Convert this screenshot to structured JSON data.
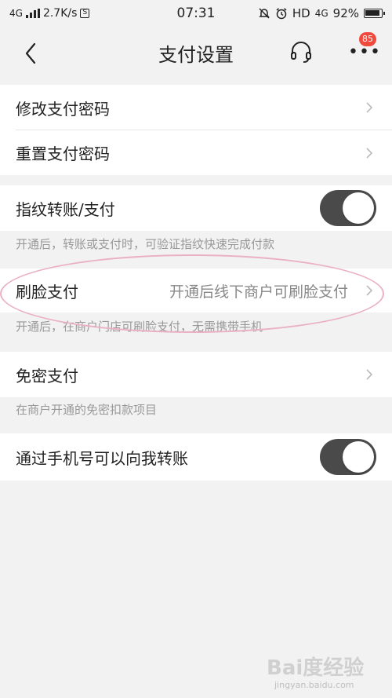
{
  "status_bar": {
    "network_type": "4G",
    "speed": "2.7K/s",
    "sim_icon_text": "S",
    "time": "07:31",
    "hd_label": "HD",
    "net_label": "4G",
    "battery": "92%"
  },
  "nav": {
    "title": "支付设置",
    "more_badge": "85",
    "back_icon": "chevron-left-icon",
    "support_icon": "headset-icon",
    "more_icon": "more-dots-icon"
  },
  "rows": {
    "change_password": {
      "label": "修改支付密码"
    },
    "reset_password": {
      "label": "重置支付密码"
    },
    "fingerprint": {
      "label": "指纹转账/支付",
      "enabled": true,
      "hint": "开通后，转账或支付时，可验证指纹快速完成付款"
    },
    "face_pay": {
      "label": "刷脸支付",
      "value": "开通后线下商户可刷脸支付",
      "hint": "开通后，在商户门店可刷脸支付，无需携带手机"
    },
    "no_password_pay": {
      "label": "免密支付",
      "hint": "在商户开通的免密扣款项目"
    },
    "phone_transfer": {
      "label": "通过手机号可以向我转账",
      "enabled": true
    }
  },
  "watermark": {
    "text": "Bai度经验",
    "url": "jingyan.baidu.com"
  },
  "colors": {
    "background": "#f2f2f2",
    "toggle_on": "#4a4a4a",
    "badge": "#f04a3e",
    "highlight": "#eab0c4"
  }
}
